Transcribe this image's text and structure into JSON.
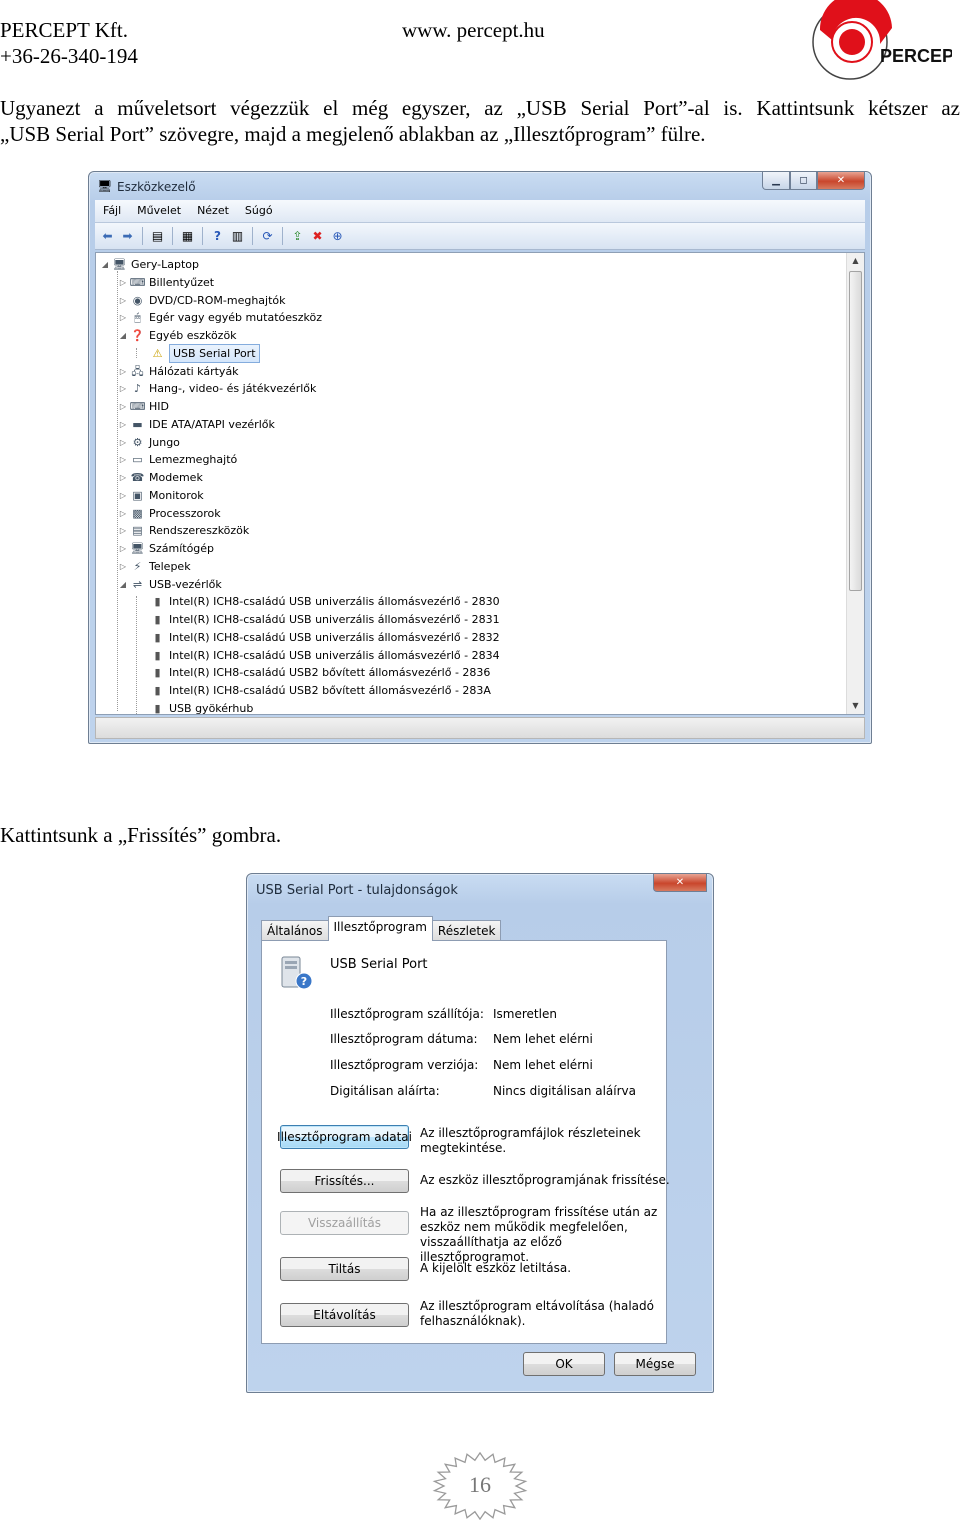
{
  "header": {
    "company": "PERCEPT Kft.",
    "phone": "+36-26-340-194",
    "website": "www. percept.hu",
    "logo_text": "PERCEPT"
  },
  "intro_paragraph": {
    "line1": "Ugyanezt a műveletsort végezzük el még egyszer, az „USB Serial Port”-al is. Kattintsunk kétszer az",
    "line2": "„USB Serial Port” szövegre, majd a megjelenő ablakban az „Illesztőprogram” fülre."
  },
  "device_manager": {
    "title": "Eszközkezelő",
    "menu": [
      "Fájl",
      "Művelet",
      "Nézet",
      "Súgó"
    ],
    "root": "Gery-Laptop",
    "categories": [
      {
        "label": "Billentyűzet",
        "icon": "keyboard-icon"
      },
      {
        "label": "DVD/CD-ROM-meghajtók",
        "icon": "disc-drive-icon"
      },
      {
        "label": "Egér vagy egyéb mutatóeszköz",
        "icon": "mouse-icon"
      },
      {
        "label": "Egyéb eszközök",
        "icon": "unknown-device-icon"
      },
      {
        "label": "USB Serial Port",
        "icon": "warning-device-icon",
        "child": true,
        "selected": true
      },
      {
        "label": "Hálózati kártyák",
        "icon": "network-icon"
      },
      {
        "label": "Hang-, video- és játékvezérlők",
        "icon": "sound-icon"
      },
      {
        "label": "HID",
        "icon": "hid-icon"
      },
      {
        "label": "IDE ATA/ATAPI vezérlők",
        "icon": "ide-controller-icon"
      },
      {
        "label": "Jungo",
        "icon": "jungo-icon"
      },
      {
        "label": "Lemezmeghajtó",
        "icon": "disk-drive-icon"
      },
      {
        "label": "Modemek",
        "icon": "modem-icon"
      },
      {
        "label": "Monitorok",
        "icon": "monitor-icon"
      },
      {
        "label": "Processzorok",
        "icon": "processor-icon"
      },
      {
        "label": "Rendszereszközök",
        "icon": "system-device-icon"
      },
      {
        "label": "Számítógép",
        "icon": "computer-icon"
      },
      {
        "label": "Telepek",
        "icon": "battery-icon"
      },
      {
        "label": "USB-vezérlők",
        "icon": "usb-icon"
      }
    ],
    "usb_children": [
      "Intel(R) ICH8-családú USB univerzális állomásvezérlő - 2830",
      "Intel(R) ICH8-családú USB univerzális állomásvezérlő - 2831",
      "Intel(R) ICH8-családú USB univerzális állomásvezérlő - 2832",
      "Intel(R) ICH8-családú USB univerzális állomásvezérlő - 2834",
      "Intel(R) ICH8-családú USB2 bővített állomásvezérlő - 2836",
      "Intel(R) ICH8-családú USB2 bővített állomásvezérlő - 283A",
      "USB gyökérhub"
    ]
  },
  "middle_paragraph": "Kattintsunk a „Frissítés” gombra.",
  "properties_dialog": {
    "title": "USB Serial Port - tulajdonságok",
    "tabs": [
      "Általános",
      "Illesztőprogram",
      "Részletek"
    ],
    "active_tab": "Illesztőprogram",
    "device_name": "USB Serial Port",
    "info": [
      {
        "label": "Illesztőprogram szállítója:",
        "value": "Ismeretlen"
      },
      {
        "label": "Illesztőprogram dátuma:",
        "value": "Nem lehet elérni"
      },
      {
        "label": "Illesztőprogram verziója:",
        "value": "Nem lehet elérni"
      },
      {
        "label": "Digitálisan aláírta:",
        "value": "Nincs digitálisan aláírva"
      }
    ],
    "actions": [
      {
        "button": "Illesztőprogram adatai",
        "desc": "Az illesztőprogramfájlok részleteinek megtekintése."
      },
      {
        "button": "Frissítés...",
        "desc": "Az eszköz illesztőprogramjának frissítése."
      },
      {
        "button": "Visszaállítás",
        "desc": "Ha az illesztőprogram frissítése után az eszköz nem működik megfelelően, visszaállíthatja az előző illesztőprogramot."
      },
      {
        "button": "Tiltás",
        "desc": "A kijelölt eszköz letiltása."
      },
      {
        "button": "Eltávolítás",
        "desc": "Az illesztőprogram eltávolítása (haladó felhasználóknak)."
      }
    ],
    "ok": "OK",
    "cancel": "Mégse"
  },
  "page_number": "16"
}
